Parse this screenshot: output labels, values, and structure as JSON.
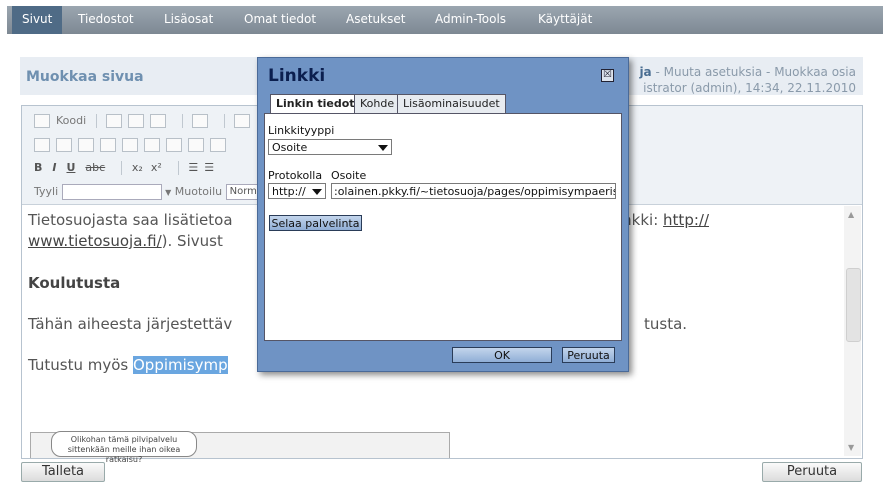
{
  "nav": {
    "items": [
      "Sivut",
      "Tiedostot",
      "Lisäosat",
      "Omat tiedot",
      "Asetukset",
      "Admin-Tools",
      "Käyttäjät"
    ],
    "active_index": 0
  },
  "page": {
    "title": "Muokkaa sivua",
    "breadcrumb_bold": "ja",
    "breadcrumb_links": " - Muuta asetuksia - Muokkaa osia",
    "meta_line": "istrator (admin), 14:34, 22.11.2010"
  },
  "toolbar": {
    "source_label": "Koodi",
    "style_label": "Tyyli",
    "format_label": "Muotoilu",
    "format_value": "Norma"
  },
  "editor_content": {
    "p1_line1_start": "Tietosuojasta saa lisätietoa",
    "p1_line1_end": "inkki: ",
    "link_part1": "http://",
    "link_part2": "www.tietosuoja.fi/",
    "p1_line2_rest": "). Sivust",
    "heading": "Koulutusta",
    "p2_start": "Tähän aiheesta järjestettäv",
    "p2_end": "tusta.",
    "p3_start": "Tutustu myös ",
    "p3_selected": "Oppimisymp",
    "image_caption_line1": "Olikohan tämä pilvipalvelu",
    "image_caption_line2": "sittenkään meille ihan oikea ratkaisu?"
  },
  "buttons": {
    "save": "Talleta",
    "cancel": "Peruuta"
  },
  "dialog": {
    "title": "Linkki",
    "close": "☒",
    "tabs": [
      "Linkin tiedot",
      "Kohde",
      "Lisäominaisuudet"
    ],
    "active_tab": 0,
    "link_type_label": "Linkkityyppi",
    "link_type_value": "Osoite",
    "protocol_label": "Protokolla",
    "protocol_value": "http://",
    "url_label": "Osoite",
    "url_value": ":olainen.pkky.fi/~tietosuoja/pages/oppimisympaeristoe.php",
    "browse_button": "Selaa palvelinta",
    "ok_button": "OK",
    "cancel_button": "Peruuta"
  },
  "colors": {
    "nav_active": "#4f6b86",
    "dialog_frame": "#6f93c4",
    "selection": "#6aa6e0"
  }
}
